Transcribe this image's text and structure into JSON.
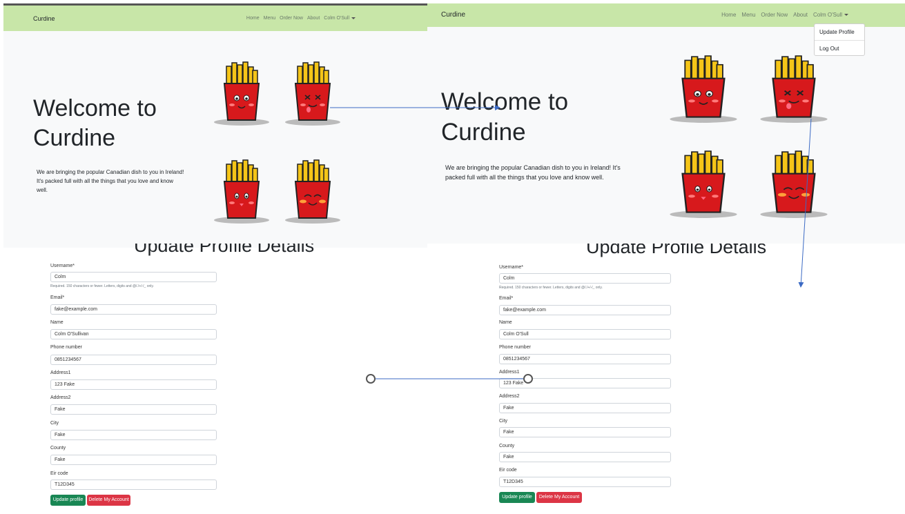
{
  "app": {
    "brand": "Curdine"
  },
  "nav_left": {
    "items": [
      "Home",
      "Menu",
      "Order Now",
      "About",
      "Colm O'Sull"
    ]
  },
  "nav_right": {
    "items": [
      "Home",
      "Menu",
      "Order Now",
      "About",
      "Colm O'Sull"
    ]
  },
  "dropdown": {
    "items": [
      "Update Profile",
      "Log Out"
    ]
  },
  "hero": {
    "title": "Welcome to Curdine",
    "text": "We are bringing the popular Canadian dish to you in Ireland! It's packed full with all the things that you love and know well."
  },
  "form": {
    "title": "Update Profile Details",
    "username_label": "Username*",
    "username_help": "Required. 150 characters or fewer. Letters, digits and @/./+/-/_ only.",
    "email_label": "Email*",
    "name_label": "Name",
    "phone_label": "Phone number",
    "address1_label": "Address1",
    "address2_label": "Address2",
    "city_label": "City",
    "county_label": "County",
    "eircode_label": "Eir code",
    "update_button": "Update profile",
    "delete_button": "Delete My Account"
  },
  "form_left": {
    "username": "Colm",
    "email": "fake@example.com",
    "name": "Colm O'Sullivan",
    "phone": "0851234567",
    "address1": "123 Fake",
    "address2": "Fake",
    "city": "Fake",
    "county": "Fake",
    "eircode": "T12D345"
  },
  "form_right": {
    "username": "Colm",
    "email": "fake@example.com",
    "name": "Colm O'Sull",
    "phone": "0851234567",
    "address1": "123 Fake",
    "address2": "Fake",
    "city": "Fake",
    "county": "Fake",
    "eircode": "T12D345"
  },
  "colors": {
    "navbar": "#c8e6a8",
    "fry_cup": "#d7191c",
    "fries": "#f5c518",
    "arrow": "#3b6ac4",
    "update_button": "#198754",
    "delete_button": "#dc3545"
  }
}
